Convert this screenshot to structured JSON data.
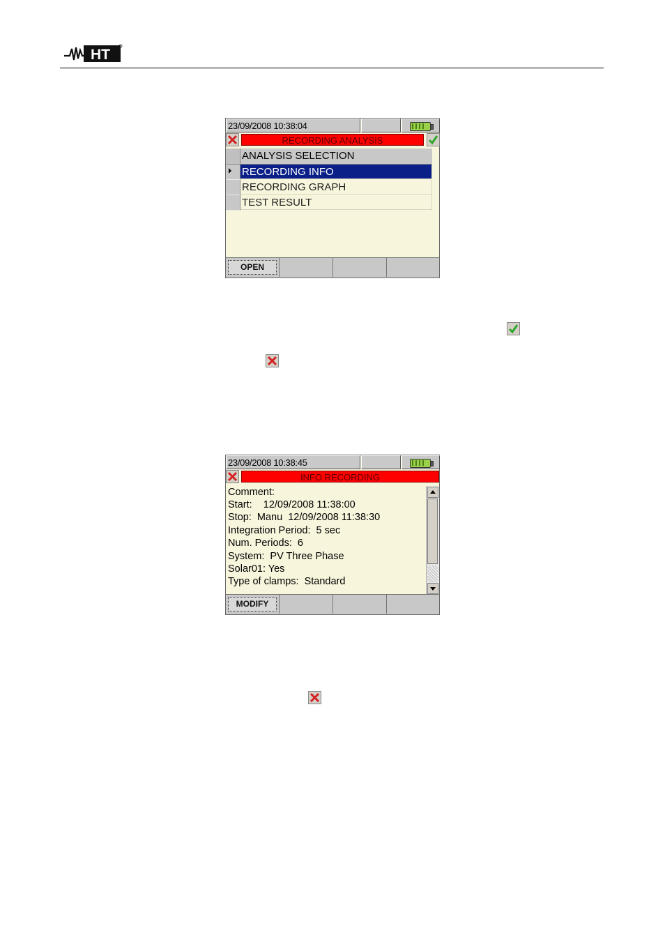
{
  "header": {
    "logo_text": "HT"
  },
  "screen1": {
    "status": {
      "datetime": "23/09/2008 10:38:04"
    },
    "title": "RECORDING ANALYSIS",
    "list_header": "ANALYSIS SELECTION",
    "items": [
      {
        "label": "RECORDING INFO",
        "selected": true
      },
      {
        "label": "RECORDING GRAPH",
        "selected": false
      },
      {
        "label": "TEST RESULT",
        "selected": false
      }
    ],
    "softkeys": [
      "OPEN",
      "",
      "",
      ""
    ]
  },
  "screen2": {
    "status": {
      "datetime": "23/09/2008 10:38:45"
    },
    "title": "INFO RECORDING",
    "lines": [
      "Comment:",
      "Start:    12/09/2008 11:38:00",
      "Stop:  Manu  12/09/2008 11:38:30",
      "Integration Period:  5 sec",
      "Num. Periods:  6",
      "System:  PV Three Phase",
      "Solar01: Yes",
      "Type of clamps:  Standard"
    ],
    "softkeys": [
      "MODIFY",
      "",
      "",
      ""
    ]
  },
  "colors": {
    "title_red": "#ff0000",
    "selection_blue": "#0a1f88",
    "screen_bg": "#f7f5dc",
    "confirm_green": "#2ea82e",
    "cancel_red": "#d42020"
  },
  "icons": [
    "ht-logo",
    "close-icon",
    "confirm-check-icon",
    "battery-icon",
    "scroll-up-icon",
    "scroll-down-icon"
  ]
}
